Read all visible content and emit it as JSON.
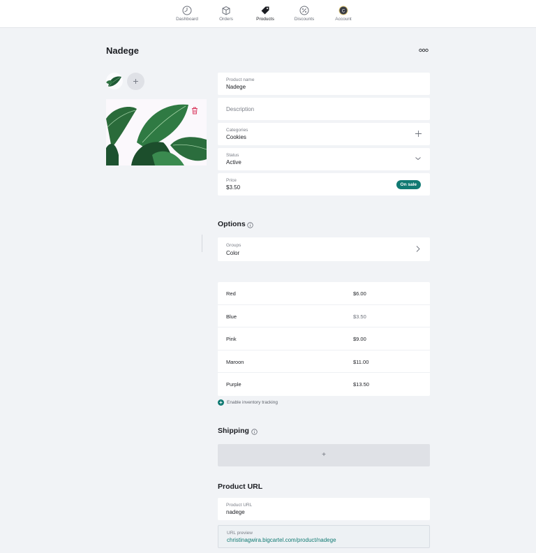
{
  "nav": {
    "items": [
      {
        "label": "Dashboard",
        "icon": "dashboard-icon"
      },
      {
        "label": "Orders",
        "icon": "box-icon"
      },
      {
        "label": "Products",
        "icon": "tag-icon"
      },
      {
        "label": "Discounts",
        "icon": "percent-icon"
      },
      {
        "label": "Account",
        "icon": "avatar-icon",
        "avatar_initial": "C"
      }
    ],
    "active": "Products"
  },
  "product": {
    "title": "Nadege",
    "fields": {
      "name_label": "Product name",
      "name_value": "Nadege",
      "description_placeholder": "Description",
      "categories_label": "Categories",
      "categories_value": "Cookies",
      "status_label": "Status",
      "status_value": "Active",
      "price_label": "Price",
      "price_value": "$3.50",
      "sale_badge": "On sale"
    }
  },
  "options": {
    "title": "Options",
    "groups_label": "Groups",
    "groups_value": "Color",
    "rows": [
      {
        "name": "Red",
        "price": "$6.00"
      },
      {
        "name": "Blue",
        "price": "$3.50"
      },
      {
        "name": "Pink",
        "price": "$9.00"
      },
      {
        "name": "Maroon",
        "price": "$11.00"
      },
      {
        "name": "Purple",
        "price": "$13.50"
      }
    ],
    "inventory_label": "Enable inventory tracking"
  },
  "shipping": {
    "title": "Shipping",
    "add_label": "+"
  },
  "url": {
    "title": "Product URL",
    "label": "Product URL",
    "value": "nadege",
    "preview_label": "URL preview",
    "preview_value": "christinagwira.bigcartel.com/product/nadege"
  },
  "colors": {
    "accent": "#117a73",
    "background": "#f1f3f6",
    "danger": "#d9365c"
  }
}
